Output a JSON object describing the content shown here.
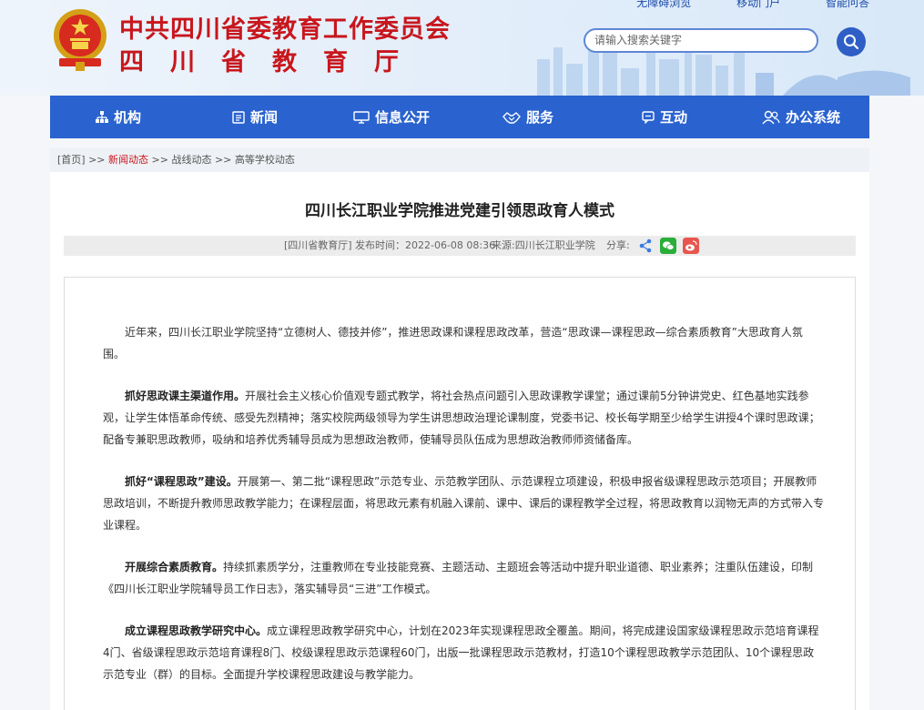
{
  "header": {
    "top_links": [
      "无障碍浏览",
      "移动门户",
      "智能问答"
    ],
    "title_line1": "中共四川省委教育工作委员会",
    "title_line2": "四川省教育厅",
    "search_placeholder": "请输入搜索关键字"
  },
  "nav": {
    "items": [
      {
        "label": "机构",
        "icon": "org-chart-icon"
      },
      {
        "label": "新闻",
        "icon": "newspaper-icon"
      },
      {
        "label": "信息公开",
        "icon": "monitor-icon"
      },
      {
        "label": "服务",
        "icon": "handshake-icon"
      },
      {
        "label": "互动",
        "icon": "chat-icon"
      },
      {
        "label": "办公系统",
        "icon": "users-icon"
      }
    ]
  },
  "breadcrumb": {
    "home": "[首页]",
    "sep": ">>",
    "level1": "新闻动态",
    "level2": "战线动态",
    "level3": "高等学校动态"
  },
  "article": {
    "title": "四川长江职业学院推进党建引领思政育人模式",
    "source_tag": "[四川省教育厅]",
    "publish_time": "发布时间：2022-06-08 08:36",
    "origin": "来源:四川长江职业学院",
    "share_label": "分享:",
    "paragraphs": [
      {
        "lead": "",
        "text": "近年来，四川长江职业学院坚持“立德树人、德技并修”，推进思政课和课程思政改革，营造“思政课—课程思政—综合素质教育”大思政育人氛围。"
      },
      {
        "lead": "抓好思政课主渠道作用。",
        "text": "开展社会主义核心价值观专题式教学，将社会热点问题引入思政课教学课堂；通过课前5分钟讲党史、红色基地实践参观，让学生体悟革命传统、感受先烈精神；落实校院两级领导为学生讲思想政治理论课制度，党委书记、校长每学期至少给学生讲授4个课时思政课；配备专兼职思政教师，吸纳和培养优秀辅导员成为思想政治教师，使辅导员队伍成为思想政治教师师资储备库。"
      },
      {
        "lead": "抓好“课程思政”建设。",
        "text": "开展第一、第二批“课程思政”示范专业、示范教学团队、示范课程立项建设，积极申报省级课程思政示范项目；开展教师思政培训，不断提升教师思政教学能力；在课程层面，将思政元素有机融入课前、课中、课后的课程教学全过程，将思政教育以润物无声的方式带入专业课程。"
      },
      {
        "lead": "开展综合素质教育。",
        "text": "持续抓素质学分，注重教师在专业技能竞赛、主题活动、主题班会等活动中提升职业道德、职业素养；注重队伍建设，印制《四川长江职业学院辅导员工作日志》，落实辅导员“三进”工作模式。"
      },
      {
        "lead": "成立课程思政教学研究中心。",
        "text": "成立课程思政教学研究中心，计划在2023年实现课程思政全覆盖。期间，将完成建设国家级课程思政示范培育课程4门、省级课程思政示范培育课程8门、校级课程思政示范课程60门，出版一批课程思政示范教材，打造10个课程思政教学示范团队、10个课程思政示范专业（群）的目标。全面提升学校课程思政建设与教学能力。"
      }
    ]
  },
  "colors": {
    "brand_red": "#c8161d",
    "nav_blue": "#2a63cf",
    "wechat_green": "#2aae3a",
    "weibo_red": "#e8554e",
    "share_blue": "#3a7be0"
  }
}
